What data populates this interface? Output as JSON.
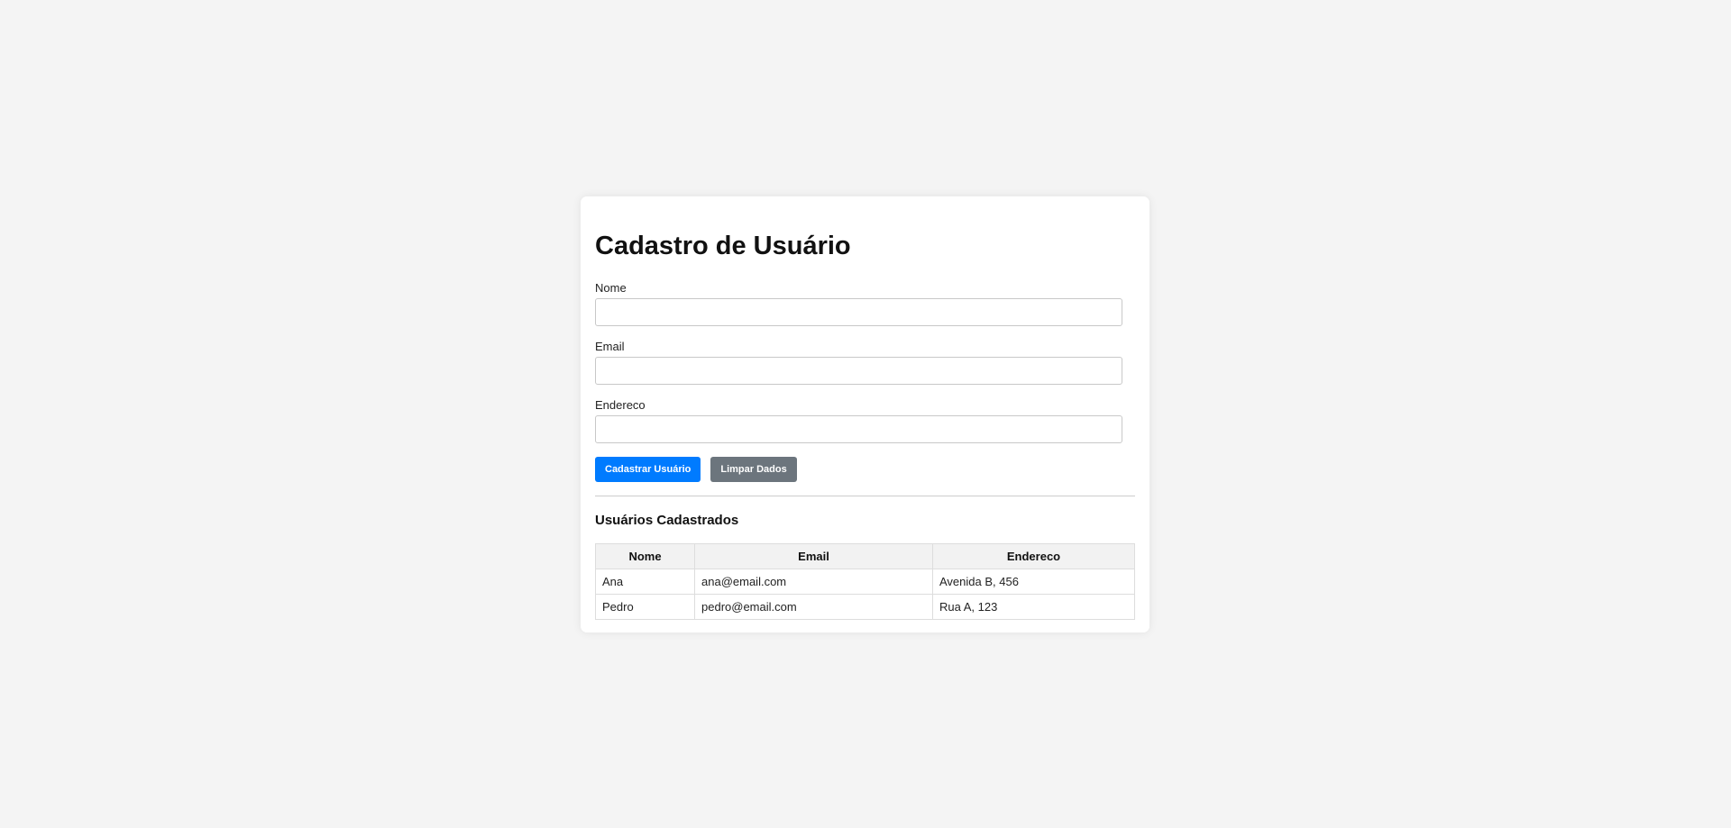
{
  "form": {
    "title": "Cadastro de Usuário",
    "fields": [
      {
        "label": "Nome",
        "value": "",
        "placeholder": ""
      },
      {
        "label": "Email",
        "value": "",
        "placeholder": ""
      },
      {
        "label": "Endereco",
        "value": "",
        "placeholder": ""
      }
    ],
    "submit_label": "Cadastrar Usuário",
    "clear_label": "Limpar Dados"
  },
  "users": {
    "heading": "Usuários Cadastrados",
    "columns": [
      "Nome",
      "Email",
      "Endereco"
    ],
    "rows": [
      [
        "Ana",
        "ana@email.com",
        "Avenida B, 456"
      ],
      [
        "Pedro",
        "pedro@email.com",
        "Rua A, 123"
      ]
    ]
  },
  "colors": {
    "primary": "#007bff",
    "secondary": "#6c757d",
    "background": "#f4f4f4"
  }
}
